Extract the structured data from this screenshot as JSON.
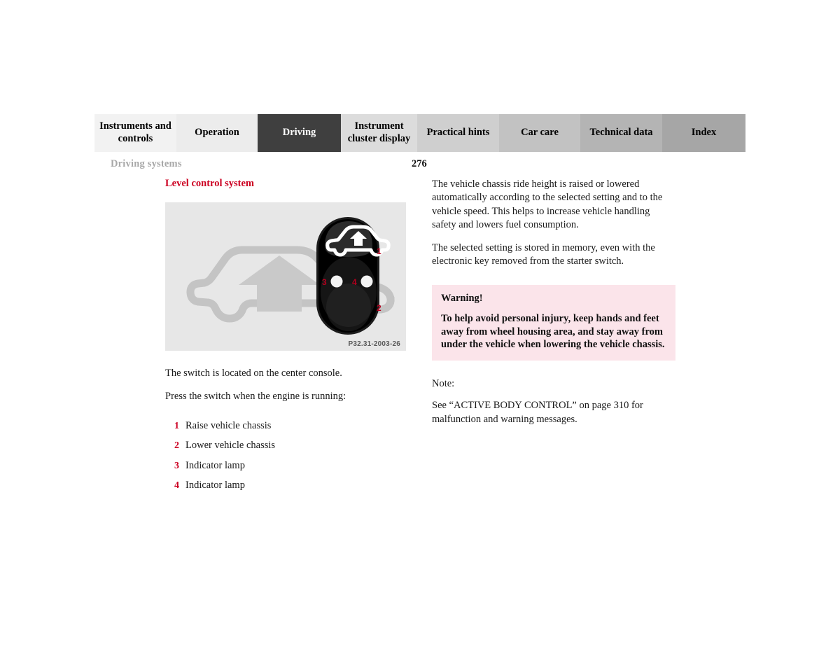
{
  "document": {
    "running_head": "Driving systems",
    "page_number": "276"
  },
  "tabs": [
    {
      "label": "Instruments and controls",
      "active": false,
      "bg": "#f2f2f2",
      "width": 117
    },
    {
      "label": "Operation",
      "active": false,
      "bg": "#ececec",
      "width": 116
    },
    {
      "label": "Driving",
      "active": true,
      "bg": "#3f3f3f",
      "width": 119
    },
    {
      "label": "Instrument cluster display",
      "active": false,
      "bg": "#dcdcdc",
      "width": 109
    },
    {
      "label": "Practical hints",
      "active": false,
      "bg": "#cfcfcf",
      "width": 117
    },
    {
      "label": "Car care",
      "active": false,
      "bg": "#c2c2c2",
      "width": 116
    },
    {
      "label": "Technical data",
      "active": false,
      "bg": "#b4b4b4",
      "width": 117
    },
    {
      "label": "Index",
      "active": false,
      "bg": "#a6a6a6",
      "width": 119
    }
  ],
  "left_column": {
    "section_title": "Level control system",
    "figure": {
      "caption": "P32.31-2003-26",
      "callouts": [
        "1",
        "2",
        "3",
        "4"
      ],
      "background_color": "#e7e7e7",
      "car_outline_color": "#c4c4c4",
      "switch_color": "#0d0d0d"
    },
    "paragraphs": [
      "The switch is located on the center console.",
      "Press the switch when the engine is running:"
    ],
    "legend": [
      {
        "num": "1",
        "label": "Raise vehicle chassis"
      },
      {
        "num": "2",
        "label": "Lower vehicle chassis"
      },
      {
        "num": "3",
        "label": "Indicator lamp"
      },
      {
        "num": "4",
        "label": "Indicator lamp"
      }
    ]
  },
  "right_column": {
    "paragraphs": [
      "The vehicle chassis ride height is raised or lowered automatically according to the selected setting and to the vehicle speed. This helps to increase vehicle handling safety and lowers fuel consumption.",
      "The selected setting is stored in memory, even with the electronic key removed from the starter switch."
    ],
    "warning": {
      "title": "Warning!",
      "text": "To help avoid personal injury, keep hands and feet away from wheel housing area, and stay away from under the vehicle when lowering the vehicle chassis.",
      "background_color": "#fbe4ea"
    },
    "note": {
      "label": "Note:",
      "text": "See “ACTIVE BODY CONTROL” on page 310 for malfunction and warning messages."
    }
  },
  "colors": {
    "accent_red": "#cc0022",
    "running_head_gray": "#a8a8a8",
    "active_tab": "#3f3f3f"
  }
}
